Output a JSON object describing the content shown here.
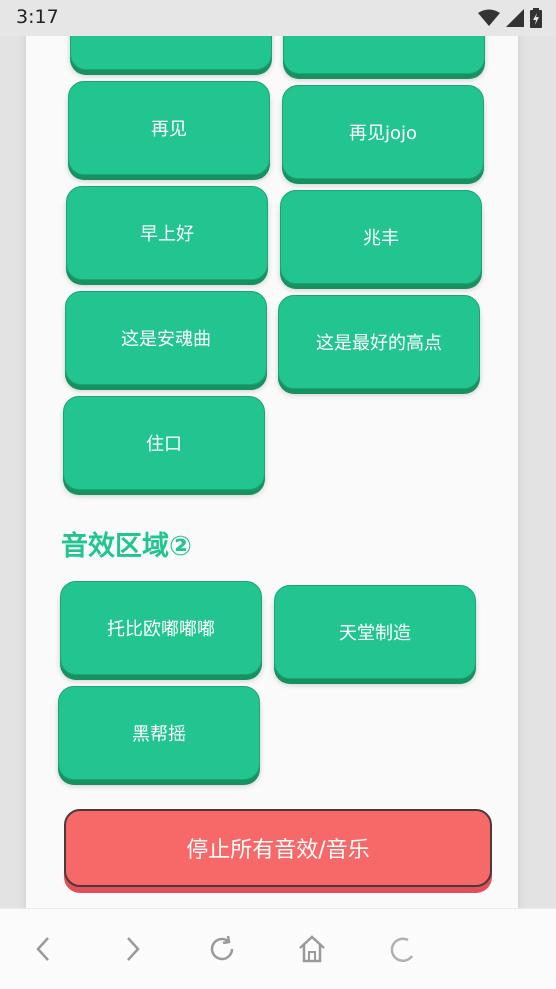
{
  "status": {
    "time": "3:17"
  },
  "section1": {
    "buttons": [
      "",
      "",
      "再见",
      "再见jojo",
      "早上好",
      "兆丰",
      "这是安魂曲",
      "这是最好的高点",
      "住口"
    ]
  },
  "section2": {
    "title": "音效区域②",
    "buttons": [
      "托比欧嘟嘟嘟",
      "天堂制造",
      "黑帮摇"
    ]
  },
  "stop_button": {
    "label": "停止所有音效/音乐"
  },
  "colors": {
    "accent": "#22c58f",
    "stop": "#f76969"
  },
  "nav": {
    "icons": [
      "back-icon",
      "forward-icon",
      "reload-icon",
      "home-icon",
      "loading-icon"
    ]
  }
}
